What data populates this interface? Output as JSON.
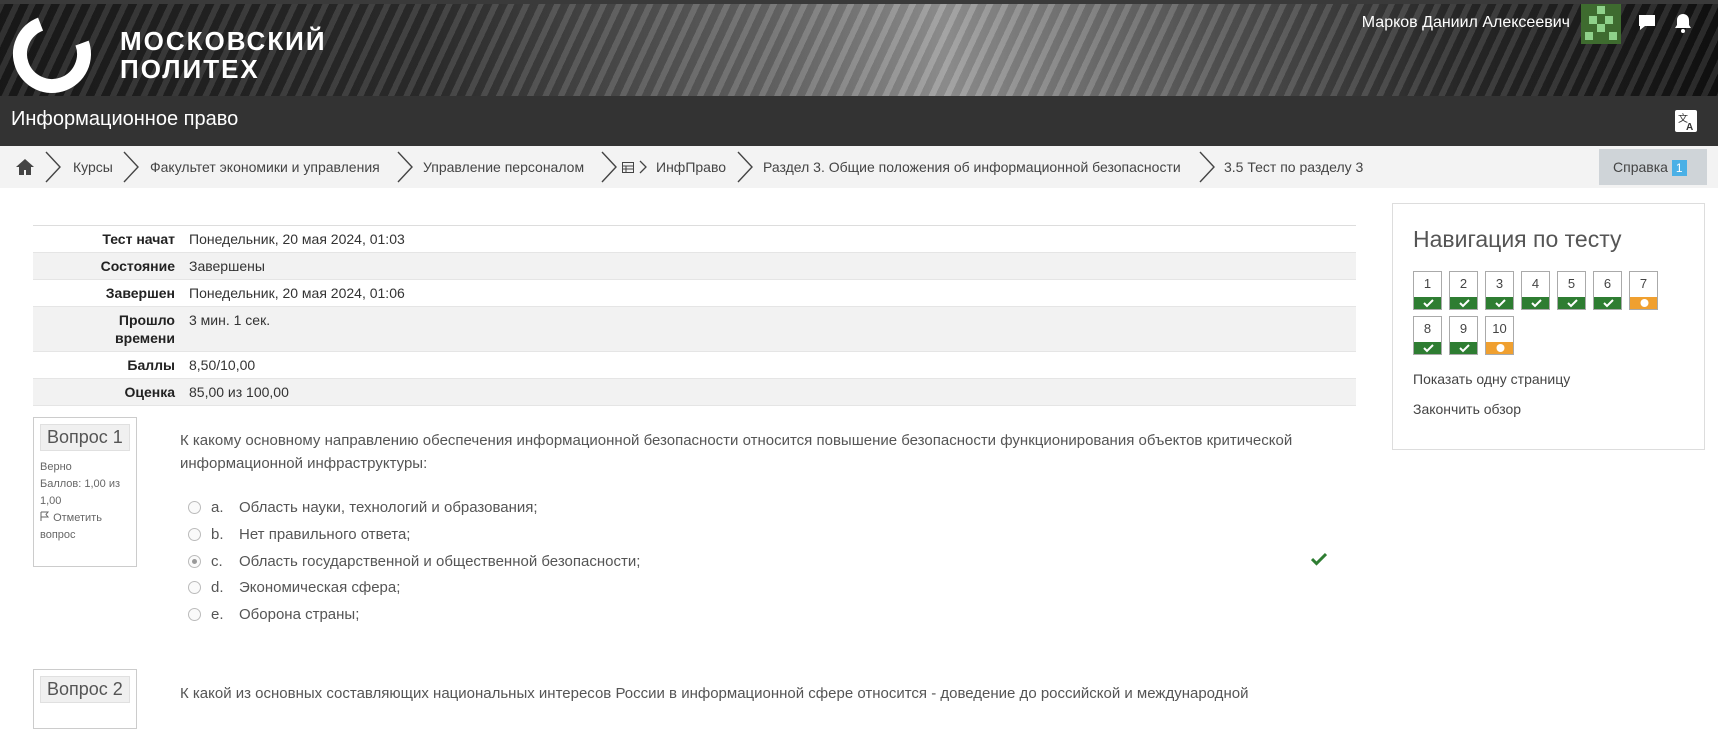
{
  "header": {
    "logo_line1": "московский",
    "logo_line2": "политех",
    "user_name": "Марков Даниил Алексеевич"
  },
  "course": {
    "title": "Информационное право"
  },
  "breadcrumb": {
    "items": [
      "Курсы",
      "Факультет экономики и управления",
      "Управление персоналом",
      "ИнфПраво",
      "Раздел 3. Общие положения об информационной безопасности",
      "3.5 Тест по разделу 3"
    ],
    "help_label": "Справка",
    "help_badge": "1"
  },
  "summary": {
    "rows": [
      {
        "label": "Тест начат",
        "value": "Понедельник, 20 мая 2024, 01:03"
      },
      {
        "label": "Состояние",
        "value": "Завершены"
      },
      {
        "label": "Завершен",
        "value": "Понедельник, 20 мая 2024, 01:06"
      },
      {
        "label": "Прошло времени",
        "value": "3 мин. 1 сек."
      },
      {
        "label": "Баллы",
        "value": "8,50/10,00"
      },
      {
        "label": "Оценка",
        "value": "85,00 из 100,00"
      }
    ]
  },
  "questions": [
    {
      "number": "Вопрос 1",
      "status": "Верно",
      "points": "Баллов: 1,00 из 1,00",
      "flag_label": "Отметить вопрос",
      "text": "К какому основному направлению обеспечения информационной безопасности относится повышение безопасности функционирования объектов критической информационной инфраструктуры:",
      "answers": [
        {
          "letter": "a.",
          "text": "Область науки, технологий и образования;"
        },
        {
          "letter": "b.",
          "text": "Нет правильного ответа;"
        },
        {
          "letter": "c.",
          "text": "Область государственной и общественной безопасности;"
        },
        {
          "letter": "d.",
          "text": "Экономическая сфера;"
        },
        {
          "letter": "e.",
          "text": "Оборона страны;"
        }
      ],
      "selected": "c.",
      "result_icon": "check-icon"
    },
    {
      "number": "Вопрос 2",
      "text": "К какой из основных составляющих национальных интересов России в информационной сфере относится - доведение до российской и международной"
    }
  ],
  "navigation": {
    "title": "Навигация по тесту",
    "buttons": [
      {
        "num": "1",
        "state": "correct"
      },
      {
        "num": "2",
        "state": "correct"
      },
      {
        "num": "3",
        "state": "correct"
      },
      {
        "num": "4",
        "state": "correct"
      },
      {
        "num": "5",
        "state": "correct"
      },
      {
        "num": "6",
        "state": "correct"
      },
      {
        "num": "7",
        "state": "partial"
      },
      {
        "num": "8",
        "state": "correct"
      },
      {
        "num": "9",
        "state": "correct"
      },
      {
        "num": "10",
        "state": "partial"
      }
    ],
    "show_one_page": "Показать одну страницу",
    "finish_review": "Закончить обзор"
  },
  "colors": {
    "correct": "#2e7d32",
    "partial": "#f0a030",
    "course_bar": "#333333",
    "help_badge": "#4ab0e6"
  }
}
